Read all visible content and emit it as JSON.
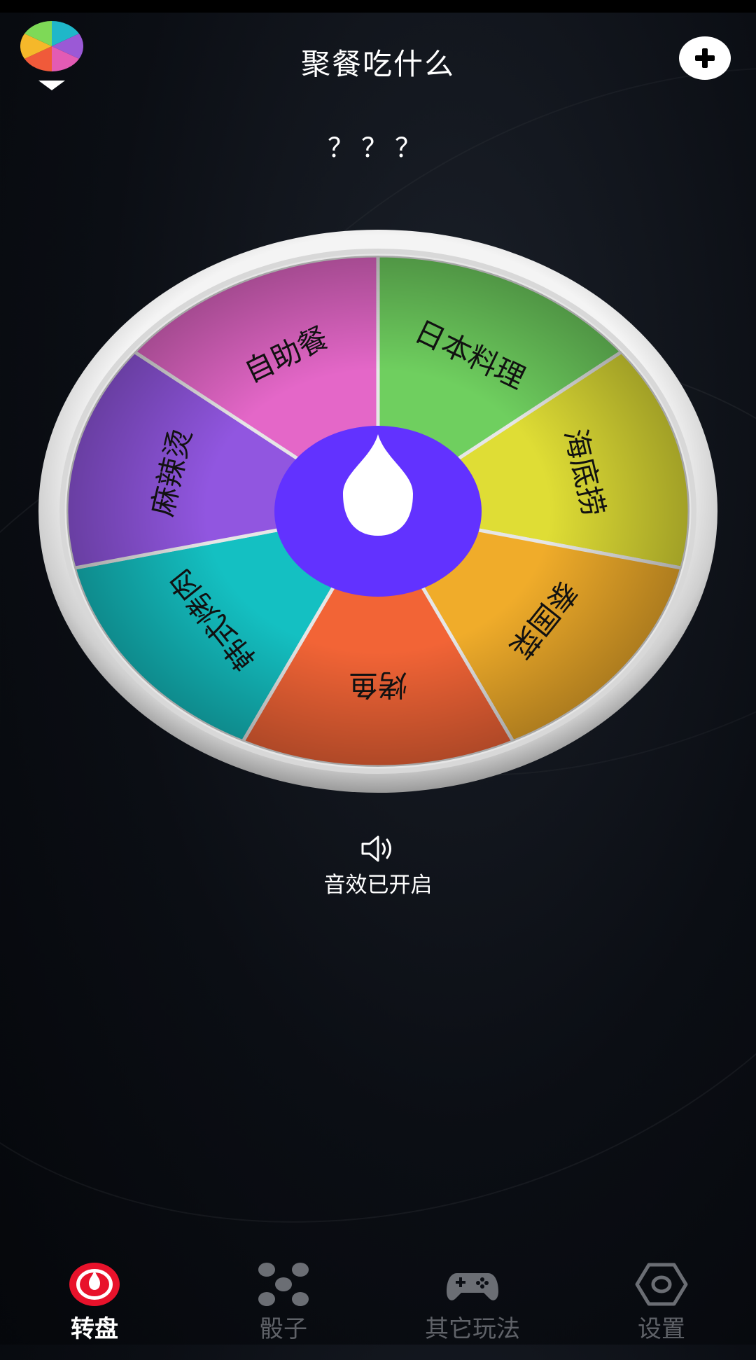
{
  "header": {
    "title": "聚餐吃什么",
    "logo_icon": "color-wheel-logo-icon",
    "add_icon": "plus-icon"
  },
  "result_text": "？？？",
  "wheel": {
    "segments": [
      {
        "label": "日本料理",
        "color": "#6fcf5f"
      },
      {
        "label": "海底捞",
        "color": "#dfdd35"
      },
      {
        "label": "泰国菜",
        "color": "#f0ac2a"
      },
      {
        "label": "烤鱼",
        "color": "#f26436"
      },
      {
        "label": "韩式烤肉",
        "color": "#14c0c2"
      },
      {
        "label": "麻辣烫",
        "color": "#9156e0"
      },
      {
        "label": "自助餐",
        "color": "#e467c8"
      }
    ],
    "hub_color": "#6232ff",
    "pointer_icon": "drop-pointer-icon"
  },
  "sound": {
    "icon": "speaker-icon",
    "label": "音效已开启"
  },
  "tabs": [
    {
      "label": "转盘",
      "icon": "wheel-tab-icon",
      "active": true
    },
    {
      "label": "骰子",
      "icon": "dice-icon",
      "active": false
    },
    {
      "label": "其它玩法",
      "icon": "gamepad-icon",
      "active": false
    },
    {
      "label": "设置",
      "icon": "settings-hexagon-icon",
      "active": false
    }
  ]
}
